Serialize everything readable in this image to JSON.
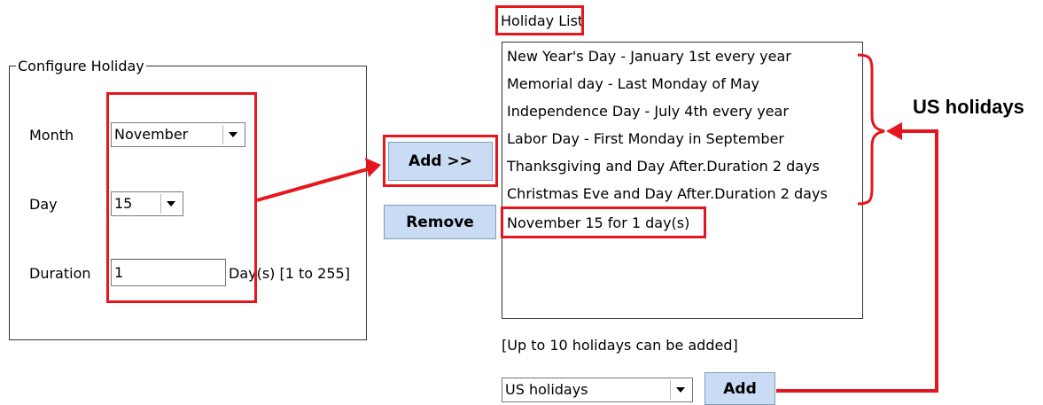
{
  "configure": {
    "group_title": "Configure Holiday",
    "month_label": "Month",
    "month_value": "November",
    "day_label": "Day",
    "day_value": "15",
    "duration_label": "Duration",
    "duration_value": "1",
    "duration_hint": "Day(s) [1 to 255]"
  },
  "buttons": {
    "add_label": "Add  >>",
    "remove_label": "Remove",
    "add_preset_label": "Add"
  },
  "holiday_list": {
    "title": "Holiday List",
    "items": [
      "New Year's Day - January 1st every year",
      "Memorial day - Last Monday of May",
      "Independence Day - July 4th every year",
      "Labor Day - First Monday in September",
      "Thanksgiving and Day After.Duration 2 days",
      "Christmas Eve and Day After.Duration 2 days",
      "November 15 for 1 day(s)"
    ],
    "limit_note": "[Up to 10 holidays can be added]"
  },
  "preset": {
    "selected": "US holidays"
  },
  "annotation": {
    "us_holidays_label": "US holidays",
    "color": "#e6161e"
  }
}
